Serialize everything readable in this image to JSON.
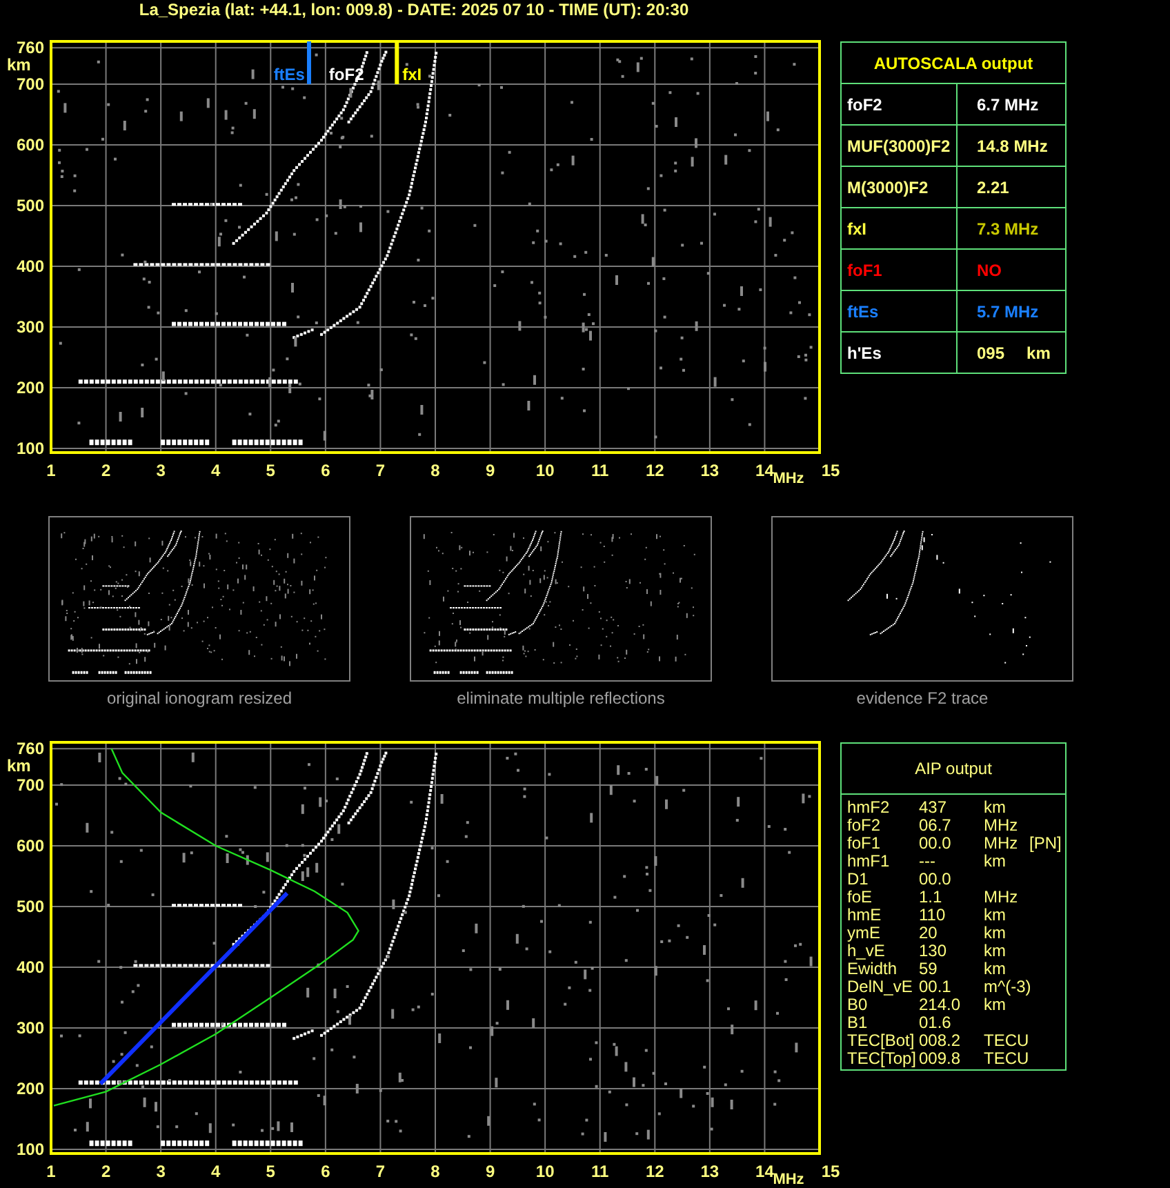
{
  "title": "La_Spezia (lat: +44.1, lon: 009.8) - DATE: 2025 07 10 - TIME (UT): 20:30",
  "ionogram": {
    "y_unit": "km",
    "y_ticks": [
      "760",
      "700",
      "600",
      "500",
      "400",
      "300",
      "200",
      "100"
    ],
    "x_ticks": [
      "1",
      "2",
      "3",
      "4",
      "5",
      "6",
      "7",
      "8",
      "9",
      "10",
      "11",
      "12",
      "13",
      "14",
      "15"
    ],
    "x_unit": "MHz",
    "markers": [
      {
        "label": "ftEs",
        "color": "#1a7fff"
      },
      {
        "label": "foF2",
        "color": "#ffffff"
      },
      {
        "label": "fxI",
        "color": "#ffff00"
      }
    ]
  },
  "autoscala": {
    "title": "AUTOSCALA output",
    "rows": [
      {
        "name": {
          "text": "foF2",
          "color": "#ffffff"
        },
        "value": {
          "text": "6.7 MHz",
          "color": "#ffffff"
        }
      },
      {
        "name": {
          "text": "MUF(3000)F2",
          "color": "#ffff80"
        },
        "value": {
          "text": "14.8 MHz",
          "color": "#ffff80"
        }
      },
      {
        "name": {
          "text": "M(3000)F2",
          "color": "#ffff80"
        },
        "value": {
          "text": "2.21",
          "color": "#ffff80"
        }
      },
      {
        "name": {
          "text": "fxI",
          "color": "#ffff40"
        },
        "value": {
          "text": "7.3 MHz",
          "color": "#c8c800"
        }
      },
      {
        "name": {
          "text": "foF1",
          "color": "#ff0000"
        },
        "value": {
          "text": "NO",
          "color": "#ff0000"
        }
      },
      {
        "name": {
          "text": "ftEs",
          "color": "#1a7fff"
        },
        "value": {
          "text": "5.7 MHz",
          "color": "#1a7fff"
        }
      },
      {
        "name": {
          "text": "h'Es",
          "color": "#ffffff"
        },
        "value": {
          "text": "095",
          "unit": "km",
          "color": "#ffff80"
        }
      }
    ]
  },
  "thumbnails": [
    {
      "kind": "original",
      "caption": "original ionogram resized"
    },
    {
      "kind": "filtered",
      "caption": "eliminate multiple reflections"
    },
    {
      "kind": "f2_trace",
      "caption": "evidence F2 trace"
    }
  ],
  "aip_ionogram": {
    "y_unit": "km",
    "y_ticks": [
      "760",
      "700",
      "600",
      "500",
      "400",
      "300",
      "200",
      "100"
    ],
    "x_ticks": [
      "1",
      "2",
      "3",
      "4",
      "5",
      "6",
      "7",
      "8",
      "9",
      "10",
      "11",
      "12",
      "13",
      "14",
      "15"
    ],
    "x_unit": "MHz"
  },
  "aip": {
    "title": "AIP output",
    "rows": [
      {
        "name": "hmF2",
        "value": "437",
        "unit": "km"
      },
      {
        "name": "foF2",
        "value": "06.7",
        "unit": "MHz"
      },
      {
        "name": "foF1",
        "value": "00.0",
        "unit": "MHz",
        "note": "[PN]"
      },
      {
        "name": "hmF1",
        "value": "---",
        "unit": "km"
      },
      {
        "name": "D1",
        "value": "00.0"
      },
      {
        "name": "foE",
        "value": "1.1",
        "unit": "MHz"
      },
      {
        "name": "hmE",
        "value": "110",
        "unit": "km"
      },
      {
        "name": "ymE",
        "value": "20",
        "unit": "km"
      },
      {
        "name": "h_vE",
        "value": "130",
        "unit": "km"
      },
      {
        "name": "Ewidth",
        "value": "59",
        "unit": "km"
      },
      {
        "name": "DelN_vE",
        "value": "00.1",
        "unit": "m^(-3)"
      },
      {
        "name": "B0",
        "value": "214.0",
        "unit": "km"
      },
      {
        "name": "B1",
        "value": "01.6"
      },
      {
        "name": "TEC[Bot]",
        "value": "008.2",
        "unit": "TECU"
      },
      {
        "name": "TEC[Top]",
        "value": "009.8",
        "unit": "TECU"
      }
    ]
  }
}
